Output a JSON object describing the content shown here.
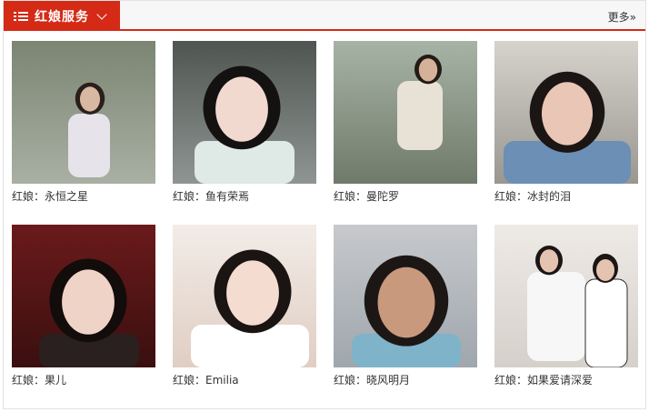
{
  "header": {
    "title": "红娘服务",
    "more_label": "更多»",
    "accent_color": "#d42a16"
  },
  "cards": [
    {
      "caption": "红娘：永恒之星",
      "colors": {
        "bg": "#7b8572",
        "bg2": "#a9b0a4",
        "skin": "#d9b8a2",
        "hair": "#2a1f1a",
        "cloth": "#e6e3ea"
      }
    },
    {
      "caption": "红娘：鱼有荣焉",
      "colors": {
        "bg": "#4f5551",
        "bg2": "#8f9592",
        "skin": "#f1d9cf",
        "hair": "#141111",
        "cloth": "#dfe9e6"
      }
    },
    {
      "caption": "红娘：曼陀罗",
      "colors": {
        "bg": "#a7b3a5",
        "bg2": "#6f7a6a",
        "skin": "#d6b19a",
        "hair": "#231a16",
        "cloth": "#e8e2d6"
      }
    },
    {
      "caption": "红娘：冰封的泪",
      "colors": {
        "bg": "#d6d2cc",
        "bg2": "#9a9690",
        "skin": "#e9c6b6",
        "hair": "#1b1514",
        "cloth": "#6b8fb5"
      }
    },
    {
      "caption": "红娘：果儿",
      "colors": {
        "bg": "#6b1a1a",
        "bg2": "#3a0f10",
        "skin": "#f0d3c7",
        "hair": "#120c0b",
        "cloth": "#2a2020"
      }
    },
    {
      "caption": "红娘：Emilia",
      "colors": {
        "bg": "#f2ece7",
        "bg2": "#e0cec3",
        "skin": "#f4dcd1",
        "hair": "#1a1413",
        "cloth": "#ffffff"
      }
    },
    {
      "caption": "红娘：晓风明月",
      "colors": {
        "bg": "#c7c9cc",
        "bg2": "#9fa6ad",
        "skin": "#c9997e",
        "hair": "#1c1715",
        "cloth": "#7fb3c9"
      }
    },
    {
      "caption": "红娘：如果爱请深爱",
      "colors": {
        "bg": "#eeeae6",
        "bg2": "#d6d0ca",
        "skin": "#e5c3b1",
        "hair": "#1b1615",
        "cloth": "#f7f7f7"
      }
    }
  ]
}
